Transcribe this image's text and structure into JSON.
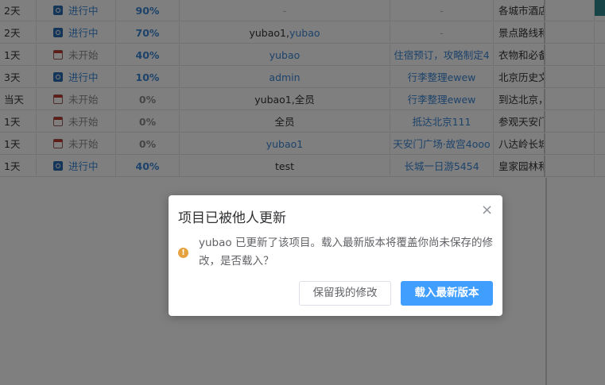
{
  "colors": {
    "accent": "#409eff",
    "link": "#3a86d6",
    "warning": "#e6a23c",
    "running_icon": "#2b6cb0",
    "not_started_icon": "#c0392b"
  },
  "table": {
    "rows": [
      {
        "duration": "2天",
        "status": "进行中",
        "status_icon": "running-icon",
        "progress": "90%",
        "progress_fraction": 0.9,
        "owner": "-",
        "predecessor": "-",
        "description": "各城市酒店"
      },
      {
        "duration": "2天",
        "status": "进行中",
        "status_icon": "running-icon",
        "progress": "70%",
        "progress_fraction": 0.7,
        "owner_a": "yubao1,",
        "owner_b": "yubao",
        "predecessor": "-",
        "description": "景点路线和"
      },
      {
        "duration": "1天",
        "status": "未开始",
        "status_icon": "not-started-icon",
        "progress": "40%",
        "progress_fraction": 0.4,
        "owner": "yubao",
        "predecessor": "住宿预订，攻略制定4",
        "description": "衣物和必备"
      },
      {
        "duration": "3天",
        "status": "进行中",
        "status_icon": "running-icon",
        "progress": "10%",
        "progress_fraction": 0.1,
        "owner": "admin",
        "predecessor": "行李整理ewew",
        "description": "北京历史文"
      },
      {
        "duration": "当天",
        "status": "未开始",
        "status_icon": "not-started-icon",
        "progress": "0%",
        "progress_fraction": 0,
        "owner": "yubao1,全员",
        "predecessor": "行李整理ewew",
        "description": "到达北京，"
      },
      {
        "duration": "1天",
        "status": "未开始",
        "status_icon": "not-started-icon",
        "progress": "0%",
        "progress_fraction": 0,
        "owner": "全员",
        "predecessor": "抵达北京111",
        "description": "参观天安门"
      },
      {
        "duration": "1天",
        "status": "未开始",
        "status_icon": "not-started-icon",
        "progress": "0%",
        "progress_fraction": 0,
        "owner": "yubao1",
        "predecessor": "天安门广场·故宫4ooo",
        "description": "八达岭长城"
      },
      {
        "duration": "1天",
        "status": "进行中",
        "status_icon": "running-icon",
        "progress": "40%",
        "progress_fraction": 0.4,
        "owner": "test",
        "predecessor": "长城一日游5454",
        "description": "皇家园林和"
      }
    ]
  },
  "dialog": {
    "title": "项目已被他人更新",
    "message": "yubao 已更新了该项目。载入最新版本将覆盖你尚未保存的修改，是否载入？",
    "keep_button": "保留我的修改",
    "load_button": "载入最新版本",
    "close_icon": "close-icon",
    "warning_icon": "warning-icon"
  }
}
